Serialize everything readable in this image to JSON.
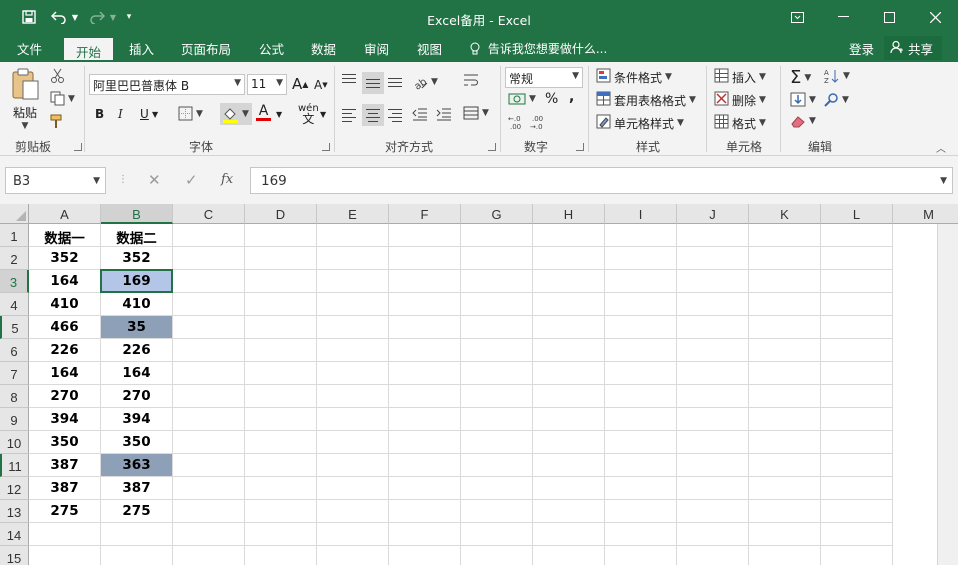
{
  "window": {
    "title": "Excel备用 - Excel"
  },
  "tabs": {
    "file": "文件",
    "home": "开始",
    "insert": "插入",
    "page_layout": "页面布局",
    "formulas": "公式",
    "data": "数据",
    "review": "审阅",
    "view": "视图"
  },
  "tell_me": "告诉我您想要做什么...",
  "account": {
    "login": "登录",
    "share": "共享"
  },
  "ribbon": {
    "clipboard": {
      "paste": "粘贴",
      "label": "剪贴板"
    },
    "font": {
      "name": "阿里巴巴普惠体 B",
      "size": "11",
      "bold": "B",
      "italic": "I",
      "underline": "U",
      "label": "字体"
    },
    "alignment": {
      "label": "对齐方式"
    },
    "number": {
      "format": "常规",
      "percent": "%",
      "comma": ",",
      "label": "数字"
    },
    "styles": {
      "conditional": "条件格式",
      "table": "套用表格格式",
      "cell": "单元格样式",
      "label": "样式"
    },
    "cells": {
      "insert": "插入",
      "delete": "删除",
      "format": "格式",
      "label": "单元格"
    },
    "editing": {
      "label": "编辑"
    }
  },
  "formula_bar": {
    "name_box": "B3",
    "cancel": "✕",
    "confirm": "✓",
    "fx": "fx",
    "content": "169"
  },
  "grid": {
    "columns": [
      "A",
      "B",
      "C",
      "D",
      "E",
      "F",
      "G",
      "H",
      "I",
      "J",
      "K",
      "L",
      "M"
    ],
    "rows": [
      "1",
      "2",
      "3",
      "4",
      "5",
      "6",
      "7",
      "8",
      "9",
      "10",
      "11",
      "12",
      "13",
      "14",
      "15"
    ],
    "col_a": [
      "数据一",
      "352",
      "164",
      "410",
      "466",
      "226",
      "164",
      "270",
      "394",
      "350",
      "387",
      "387",
      "275"
    ],
    "col_b": [
      "数据二",
      "352",
      "169",
      "410",
      "35",
      "226",
      "164",
      "270",
      "394",
      "350",
      "363",
      "387",
      "275"
    ],
    "active_cell": "B3",
    "highlight_color_active": "#b4c6e7",
    "highlight_color_diff": "#8ea0b8"
  },
  "colors": {
    "accent": "#217346"
  }
}
